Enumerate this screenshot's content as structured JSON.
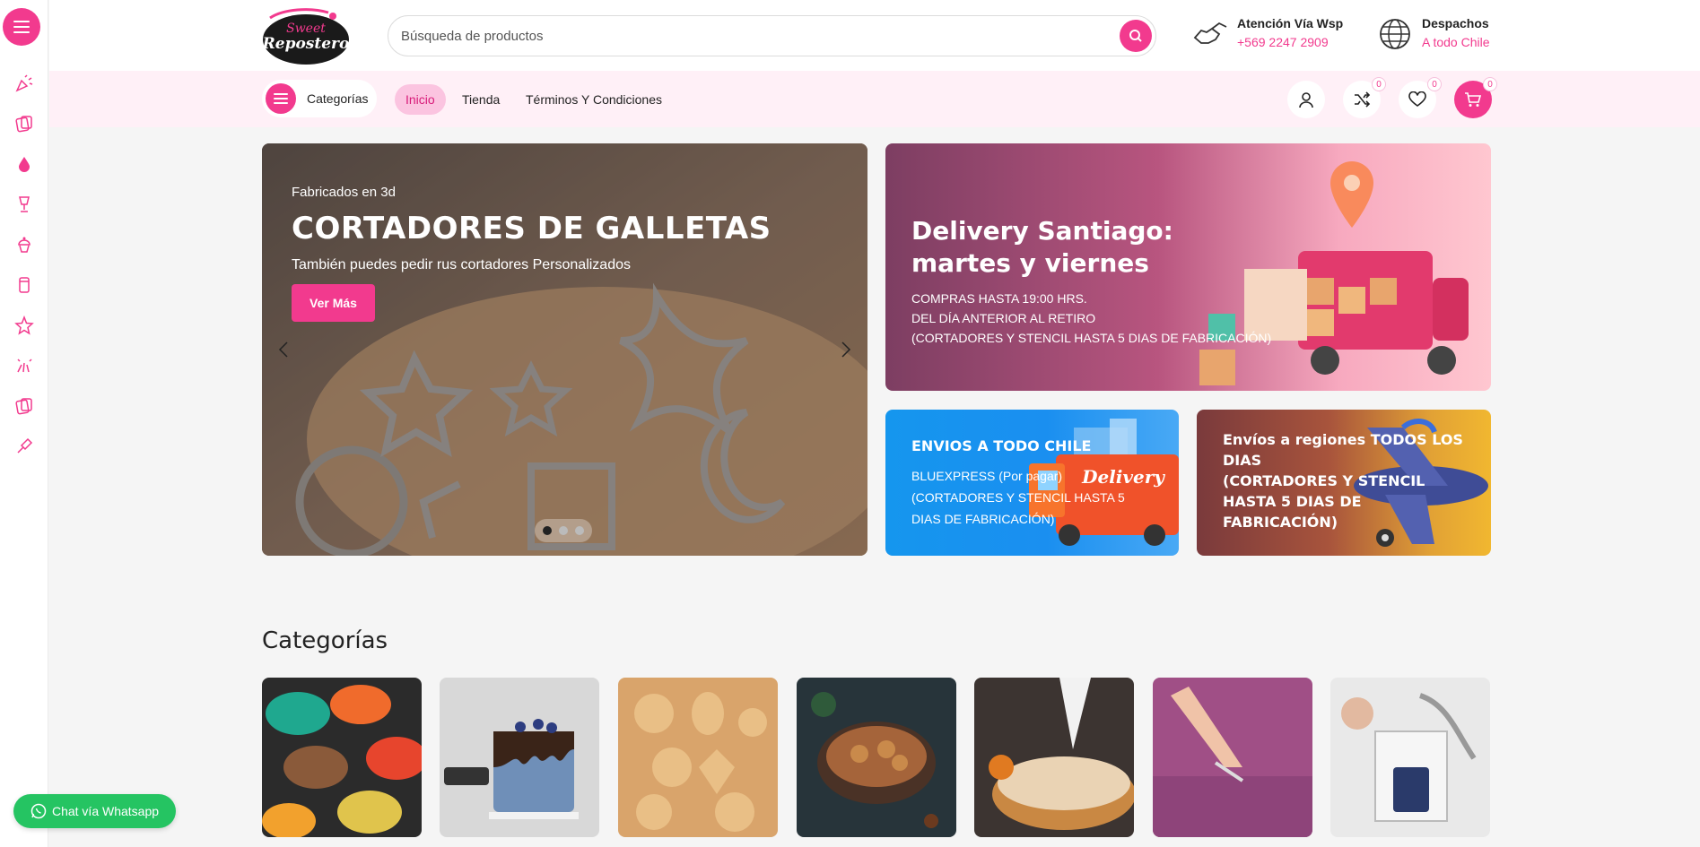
{
  "rail": {
    "icons": [
      "party-popper-icon",
      "cookie-cutter-icon",
      "drop-icon",
      "trophy-cup-icon",
      "cupcake-icon",
      "box-icon",
      "star-icon",
      "sparkle-icon",
      "cutter-box-icon",
      "piping-bag-icon"
    ]
  },
  "header": {
    "logo_text": "Sweet Repostero",
    "search_placeholder": "Búsqueda de productos",
    "contact_wsp_title": "Atención Vía Wsp",
    "contact_wsp_phone": "+569 2247 2909",
    "contact_ship_title": "Despachos",
    "contact_ship_sub": "A todo Chile"
  },
  "nav": {
    "categories_label": "Categorías",
    "links": [
      "Inicio",
      "Tienda",
      "Términos Y Condiciones"
    ],
    "active_link": "Inicio",
    "compare_count": "0",
    "wishlist_count": "0",
    "cart_count": "0"
  },
  "hero": {
    "kicker": "Fabricados en 3d",
    "title": "CORTADORES DE GALLETAS",
    "subtitle": "También puedes pedir rus cortadores Personalizados",
    "button_label": "Ver Más",
    "slides": 3,
    "active_slide": 1
  },
  "banners": {
    "delivery": {
      "title_line1": "Delivery Santiago:",
      "title_line2": "martes y viernes",
      "line1": "COMPRAS HASTA 19:00 HRS.",
      "line2": "DEL DÍA ANTERIOR AL RETIRO",
      "line3": "(CORTADORES Y STENCIL HASTA 5 DIAS DE FABRICACIÓN)"
    },
    "envios": {
      "title": "ENVIOS A TODO CHILE",
      "line1": "BLUEXPRESS (Por pagar)",
      "line2": "(CORTADORES Y STENCIL HASTA 5",
      "line3": "DIAS DE FABRICACIÓN)",
      "truck_text": "Delivery"
    },
    "regiones": {
      "line1": "Envíos a regiones TODOS LOS",
      "line2": "DIAS",
      "line3": "(CORTADORES Y STENCIL",
      "line4": "HASTA 5 DIAS DE",
      "line5": "FABRICACIÓN)"
    }
  },
  "categories": {
    "title": "Categorías",
    "tiles": [
      "macarons",
      "blue-drip-cake",
      "cookie-cutters-dough",
      "gingerbread-bowl",
      "meringue-pie",
      "fondant-cutting",
      "gift-box"
    ]
  },
  "whatsapp": {
    "label": "Chat vía Whatsapp"
  },
  "colors": {
    "brand": "#f23a8e",
    "nav_bg": "#fff0f7",
    "whatsapp": "#25c462"
  }
}
